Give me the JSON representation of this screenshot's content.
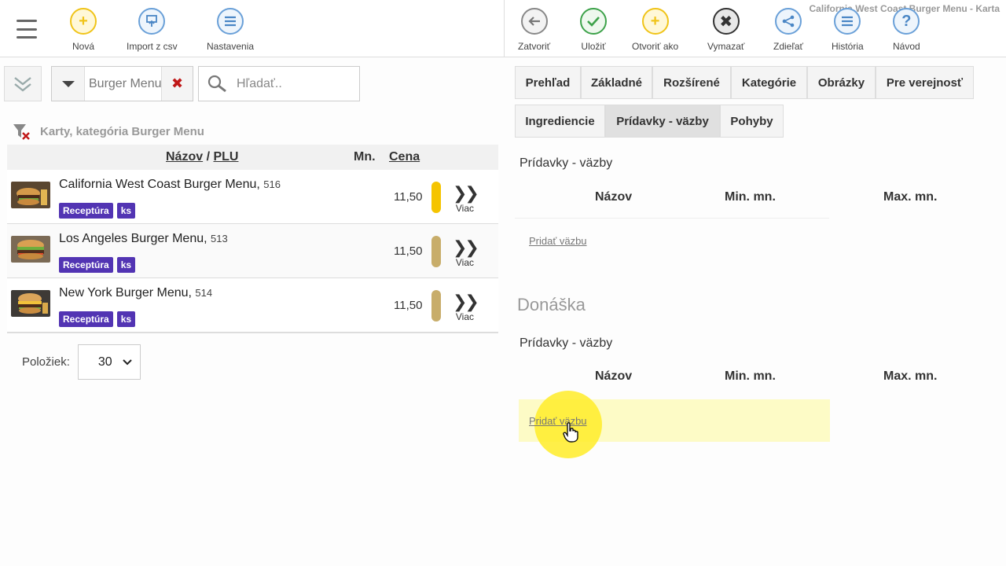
{
  "window_title": "California West Coast Burger Menu - Karta",
  "left_toolbar": {
    "buttons": [
      {
        "label": "Nová",
        "icon": "plus-icon"
      },
      {
        "label": "Import z csv",
        "icon": "import-icon"
      },
      {
        "label": "Nastavenia",
        "icon": "settings-list-icon"
      }
    ]
  },
  "right_toolbar": {
    "buttons": [
      {
        "label": "Zatvoriť",
        "icon": "back-arrow-icon"
      },
      {
        "label": "Uložiť",
        "icon": "check-icon"
      },
      {
        "label": "Otvoriť ako",
        "icon": "plus-icon"
      },
      {
        "label": "Vymazať",
        "icon": "delete-x-icon"
      },
      {
        "label": "Zdieľať",
        "icon": "share-icon"
      },
      {
        "label": "História",
        "icon": "history-list-icon"
      },
      {
        "label": "Návod",
        "icon": "help-icon"
      }
    ]
  },
  "filter": {
    "category": "Burger Menu",
    "search_placeholder": "Hľadať.."
  },
  "list": {
    "title": "Karty, kategória Burger Menu",
    "columns": {
      "name": "Názov",
      "separator": "/",
      "plu": "PLU",
      "qty": "Mn.",
      "price": "Cena"
    },
    "rows": [
      {
        "name": "California West Coast Burger Menu",
        "plu": "516",
        "tags": [
          "Receptúra",
          "ks"
        ],
        "price": "11,50",
        "bar_color": "#f5c400",
        "more": "Viac"
      },
      {
        "name": "Los Angeles Burger Menu",
        "plu": "513",
        "tags": [
          "Receptúra",
          "ks"
        ],
        "price": "11,50",
        "bar_color": "#c8ad6a",
        "more": "Viac"
      },
      {
        "name": "New York Burger Menu",
        "plu": "514",
        "tags": [
          "Receptúra",
          "ks"
        ],
        "price": "11,50",
        "bar_color": "#c8ad6a",
        "more": "Viac"
      }
    ]
  },
  "pager": {
    "label": "Položiek:",
    "value": "30"
  },
  "tabs": [
    {
      "label": "Prehľad"
    },
    {
      "label": "Základné"
    },
    {
      "label": "Rozšírené"
    },
    {
      "label": "Kategórie"
    },
    {
      "label": "Obrázky"
    },
    {
      "label": "Pre verejnosť"
    },
    {
      "label": "Ingrediencie"
    },
    {
      "label": "Prídavky - väzby",
      "active": true
    },
    {
      "label": "Pohyby"
    }
  ],
  "section1": {
    "label": "Prídavky - väzby",
    "columns": [
      "Názov",
      "Min. mn.",
      "Max. mn."
    ],
    "add_link": "Pridať väzbu"
  },
  "delivery": {
    "title": "Donáška",
    "label": "Prídavky - väzby",
    "columns": [
      "Názov",
      "Min. mn.",
      "Max. mn."
    ],
    "add_link": "Pridať väzbu"
  }
}
